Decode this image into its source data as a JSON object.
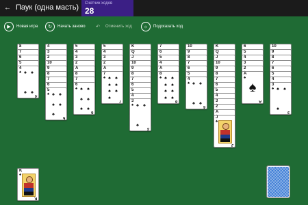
{
  "app": {
    "title": "Паук (одна масть)"
  },
  "score": {
    "label": "Счетчик ходов",
    "value": "28"
  },
  "toolbar": {
    "new_game": "Новая игра",
    "restart": "Начать заново",
    "undo": "Отменить ход",
    "hint": "Подсказать ход"
  },
  "colors": {
    "table": "#1f6b34",
    "topbar": "#1b1b1b",
    "score_bg": "#3b1f85",
    "card_back": "#3a7bd5"
  },
  "suit_symbol": "♠",
  "tableau": [
    {
      "down": 0,
      "up": [
        "8",
        "7",
        "6",
        "5",
        "4"
      ]
    },
    {
      "down": 0,
      "up": [
        "4",
        "3",
        "2",
        "10",
        "9",
        "8",
        "7",
        "6",
        "5"
      ]
    },
    {
      "down": 0,
      "up": [
        "5",
        "4",
        "3",
        "2",
        "A",
        "8",
        "7",
        "6"
      ]
    },
    {
      "down": 0,
      "up": [
        "5",
        "4",
        "3",
        "2",
        "A",
        "7"
      ]
    },
    {
      "down": 0,
      "up": [
        "K",
        "Q",
        "J",
        "10",
        "9",
        "8",
        "7",
        "6",
        "5",
        "4",
        "3"
      ]
    },
    {
      "down": 0,
      "up": [
        "7",
        "6",
        "5",
        "4",
        "A",
        "8"
      ]
    },
    {
      "down": 0,
      "up": [
        "10",
        "9",
        "8",
        "7",
        "6",
        "5",
        "4"
      ]
    },
    {
      "down": 0,
      "up": [
        "K",
        "Q",
        "J",
        "10",
        "9",
        "8",
        "7",
        "6",
        "5",
        "4",
        "3",
        "2",
        "A",
        "J"
      ]
    },
    {
      "down": 0,
      "up": [
        "6",
        "5",
        "4",
        "3",
        "2",
        "A"
      ]
    },
    {
      "down": 0,
      "up": [
        "10",
        "9",
        "8",
        "7",
        "6",
        "5",
        "4",
        "3"
      ]
    }
  ],
  "foundation": {
    "rank": "K"
  },
  "stock": {
    "label": "stock"
  }
}
